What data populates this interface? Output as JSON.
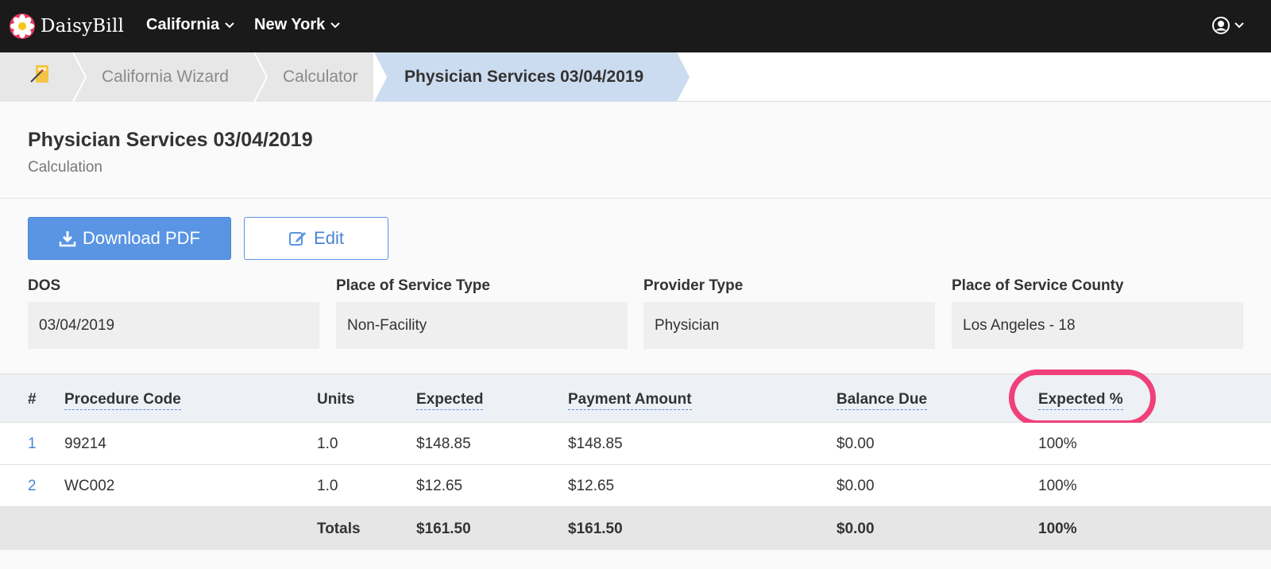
{
  "app": {
    "brand": "DaisyBill",
    "nav": [
      "California",
      "New York"
    ]
  },
  "breadcrumb": {
    "items": [
      "California Wizard",
      "Calculator",
      "Physician Services 03/04/2019"
    ]
  },
  "header": {
    "title": "Physician Services 03/04/2019",
    "subtitle": "Calculation"
  },
  "actions": {
    "download_label": "Download PDF",
    "edit_label": "Edit"
  },
  "fields": [
    {
      "label": "DOS",
      "value": "03/04/2019"
    },
    {
      "label": "Place of Service Type",
      "value": "Non-Facility"
    },
    {
      "label": "Provider Type",
      "value": "Physician"
    },
    {
      "label": "Place of Service County",
      "value": "Los Angeles - 18"
    }
  ],
  "table": {
    "columns": [
      "#",
      "Procedure Code",
      "Units",
      "Expected",
      "Payment Amount",
      "Balance Due",
      "Expected %"
    ],
    "rows": [
      {
        "num": "1",
        "code": "99214",
        "units": "1.0",
        "expected": "$148.85",
        "payment": "$148.85",
        "balance": "$0.00",
        "pct": "100%"
      },
      {
        "num": "2",
        "code": "WC002",
        "units": "1.0",
        "expected": "$12.65",
        "payment": "$12.65",
        "balance": "$0.00",
        "pct": "100%"
      }
    ],
    "totals": {
      "label": "Totals",
      "expected": "$161.50",
      "payment": "$161.50",
      "balance": "$0.00",
      "pct": "100%"
    }
  },
  "colors": {
    "accent": "#5a95e3",
    "highlight": "#f0407a",
    "active_crumb": "#ccdcf0"
  }
}
